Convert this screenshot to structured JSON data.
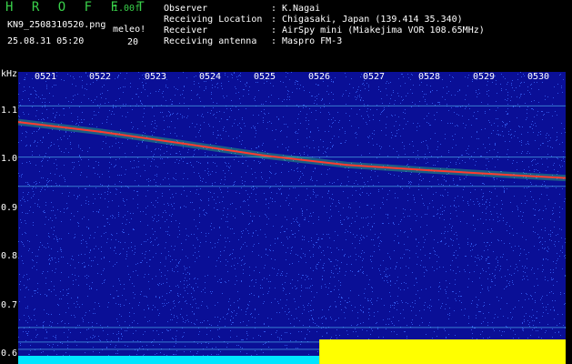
{
  "header": {
    "app_title": "H R O F F T",
    "filename": "KN9_2508310520.png",
    "timestamp": "25.08.31 05:20",
    "freq_scale": "1.00f",
    "meleo_label": "meleo!",
    "meleo_value": "20"
  },
  "info": [
    {
      "label": "Observer",
      "sep": ":",
      "value": "K.Nagai"
    },
    {
      "label": "Receiving Location",
      "sep": ":",
      "value": "Chigasaki, Japan (139.414 35.340)"
    },
    {
      "label": "Receiver",
      "sep": ":",
      "value": "AirSpy mini (Miakejima VOR 108.65MHz)"
    },
    {
      "label": "Receiving antenna",
      "sep": ":",
      "value": "Maspro FM-3"
    }
  ],
  "colors": {
    "background": "#0a0f96",
    "noise": "#3c6cff",
    "trace": "#ff3b30",
    "trace_glow": "#3cf06a",
    "yellow_bar": "#ffff00",
    "cyan_bar": "#00e5ff",
    "green_text": "#39d04a"
  },
  "chart_data": {
    "type": "heatmap",
    "xlabel": "",
    "ylabel": "kHz",
    "x_ticks": [
      "0521",
      "0522",
      "0523",
      "0524",
      "0525",
      "0526",
      "0527",
      "0528",
      "0529",
      "0530"
    ],
    "y_ticks": [
      "1.1",
      "1.0",
      "0.9",
      "0.8",
      "0.7",
      "0.6"
    ],
    "ylim": [
      0.58,
      1.18
    ],
    "xlim": [
      520.5,
      530.5
    ],
    "series": [
      {
        "values": [
          {
            "x": 520.5,
            "y": 1.077
          },
          {
            "x": 522.0,
            "y": 1.057
          },
          {
            "x": 523.5,
            "y": 1.033
          },
          {
            "x": 525.0,
            "y": 1.008
          },
          {
            "x": 526.5,
            "y": 0.989
          },
          {
            "x": 528.0,
            "y": 0.978
          },
          {
            "x": 529.5,
            "y": 0.968
          },
          {
            "x": 530.5,
            "y": 0.962
          }
        ]
      }
    ],
    "hlines": [
      1.11,
      1.005,
      0.945,
      0.655,
      0.625,
      0.61
    ],
    "activity_bars": [
      {
        "from": 520.5,
        "to": 526.0,
        "level": "low",
        "color": "cyan"
      },
      {
        "from": 526.0,
        "to": 530.5,
        "level": "high",
        "color": "yellow"
      }
    ],
    "grid": false
  }
}
